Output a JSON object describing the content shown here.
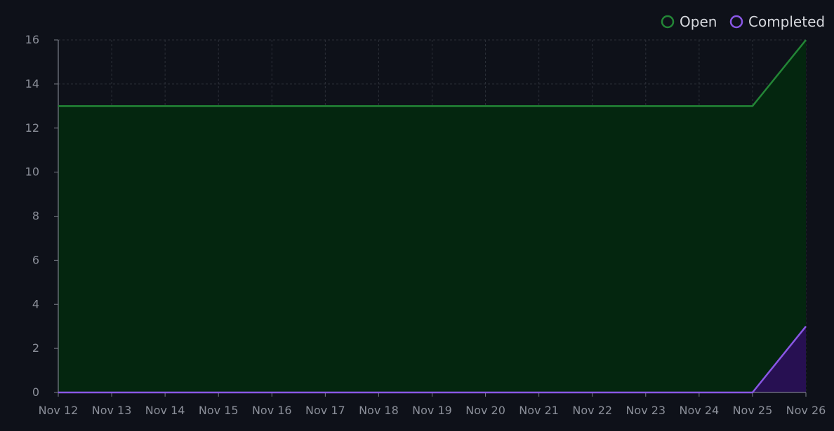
{
  "chart_data": {
    "type": "area",
    "title": "",
    "xlabel": "",
    "ylabel": "",
    "categories": [
      "Nov 12",
      "Nov 13",
      "Nov 14",
      "Nov 15",
      "Nov 16",
      "Nov 17",
      "Nov 18",
      "Nov 19",
      "Nov 20",
      "Nov 21",
      "Nov 22",
      "Nov 23",
      "Nov 24",
      "Nov 25",
      "Nov 26"
    ],
    "series": [
      {
        "name": "Open",
        "values": [
          13,
          13,
          13,
          13,
          13,
          13,
          13,
          13,
          13,
          13,
          13,
          13,
          13,
          13,
          16
        ],
        "line_color": "#238636",
        "fill_color": "#04260f"
      },
      {
        "name": "Completed",
        "values": [
          0,
          0,
          0,
          0,
          0,
          0,
          0,
          0,
          0,
          0,
          0,
          0,
          0,
          0,
          3
        ],
        "line_color": "#8957e5",
        "fill_color": "#271052"
      }
    ],
    "ylim": [
      0,
      16
    ],
    "yticks": [
      0,
      2,
      4,
      6,
      8,
      10,
      12,
      14,
      16
    ],
    "grid": true,
    "legend_position": "top-right"
  },
  "colors": {
    "background": "#0e1119",
    "grid": "#2c3038",
    "axis": "#7a7e88",
    "tick_text": "#8b8f99",
    "legend_text": "#d6d8dd"
  }
}
